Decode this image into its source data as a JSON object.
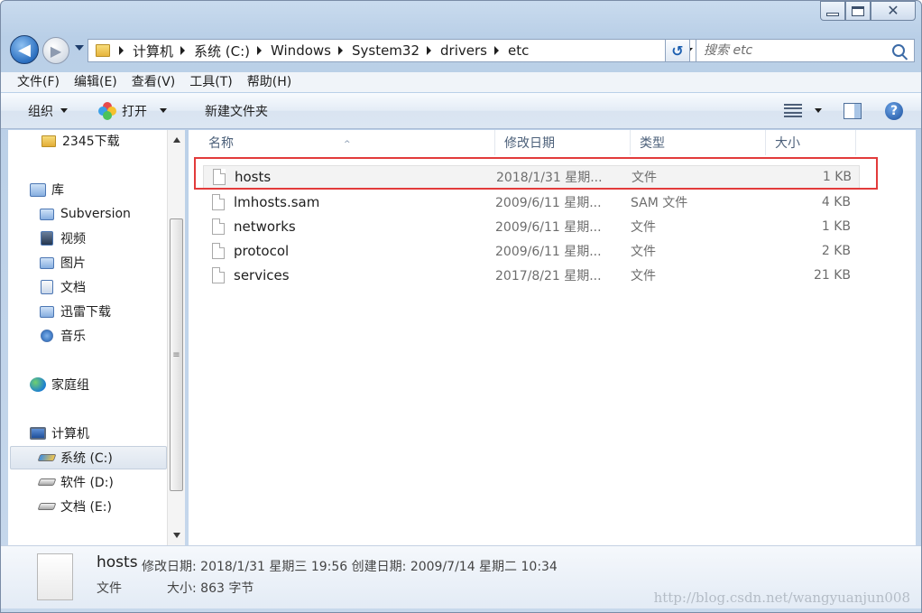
{
  "window": {
    "caption": {
      "close_glyph": "✕"
    },
    "nav": {
      "back_glyph": "◀",
      "forward_glyph": "▶",
      "refresh_glyph": "↺"
    }
  },
  "address": {
    "crumbs": [
      "计算机",
      "系统 (C:)",
      "Windows",
      "System32",
      "drivers",
      "etc"
    ]
  },
  "search": {
    "placeholder": "搜索 etc"
  },
  "menubar": {
    "items": [
      "文件(F)",
      "编辑(E)",
      "查看(V)",
      "工具(T)",
      "帮助(H)"
    ]
  },
  "toolbar": {
    "organize": "组织",
    "open": "打开",
    "new_folder": "新建文件夹",
    "help_glyph": "?"
  },
  "sidebar": {
    "items": [
      {
        "label": "2345下载",
        "icon": "folder-icon"
      },
      {
        "label": "库",
        "icon": "library-icon"
      },
      {
        "label": "Subversion",
        "icon": "library-icon"
      },
      {
        "label": "视频",
        "icon": "video-library-icon"
      },
      {
        "label": "图片",
        "icon": "picture-library-icon"
      },
      {
        "label": "文档",
        "icon": "document-library-icon"
      },
      {
        "label": "迅雷下载",
        "icon": "library-icon"
      },
      {
        "label": "音乐",
        "icon": "music-library-icon"
      },
      {
        "label": "家庭组",
        "icon": "homegroup-icon"
      },
      {
        "label": "计算机",
        "icon": "computer-icon"
      },
      {
        "label": "系统 (C:)",
        "icon": "drive-icon"
      },
      {
        "label": "软件 (D:)",
        "icon": "drive-icon"
      },
      {
        "label": "文档 (E:)",
        "icon": "drive-icon"
      }
    ],
    "selected": "系统 (C:)",
    "scroll_glyph": "≡"
  },
  "columns": {
    "name": "名称",
    "modified": "修改日期",
    "type": "类型",
    "size": "大小",
    "sort_glyph": "^"
  },
  "files": [
    {
      "name": "hosts",
      "modified": "2018/1/31 星期...",
      "type": "文件",
      "size": "1 KB"
    },
    {
      "name": "lmhosts.sam",
      "modified": "2009/6/11 星期...",
      "type": "SAM 文件",
      "size": "4 KB"
    },
    {
      "name": "networks",
      "modified": "2009/6/11 星期...",
      "type": "文件",
      "size": "1 KB"
    },
    {
      "name": "protocol",
      "modified": "2009/6/11 星期...",
      "type": "文件",
      "size": "2 KB"
    },
    {
      "name": "services",
      "modified": "2017/8/21 星期...",
      "type": "文件",
      "size": "21 KB"
    }
  ],
  "details": {
    "name": "hosts",
    "meta": "修改日期: 2018/1/31 星期三 19:56  创建日期: 2009/7/14 星期二 10:34",
    "type": "文件",
    "size": "大小: 863 字节"
  },
  "watermark": "http://blog.csdn.net/wangyuanjun008",
  "colors": {
    "highlight": "#e23b3b",
    "chrome": "#c9dbee"
  }
}
